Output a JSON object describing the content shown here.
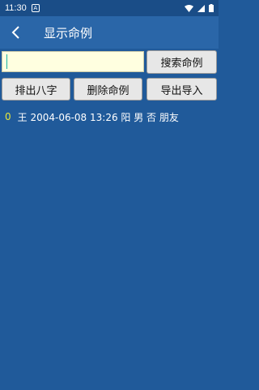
{
  "status_bar": {
    "time": "11:30",
    "badge": "A"
  },
  "app_bar": {
    "title": "显示命例"
  },
  "search": {
    "value": "",
    "placeholder": ""
  },
  "buttons": {
    "search": "搜索命例",
    "bazi": "排出八字",
    "delete": "删除命例",
    "export_import": "导出导入"
  },
  "records": [
    {
      "index": "0",
      "text": "王 2004-06-08 13:26 阳 男 否 朋友"
    }
  ],
  "colors": {
    "background": "#205a9a",
    "app_bar": "#2a66a8",
    "input_bg": "#ffffe0",
    "index_color": "#e6e63a"
  }
}
